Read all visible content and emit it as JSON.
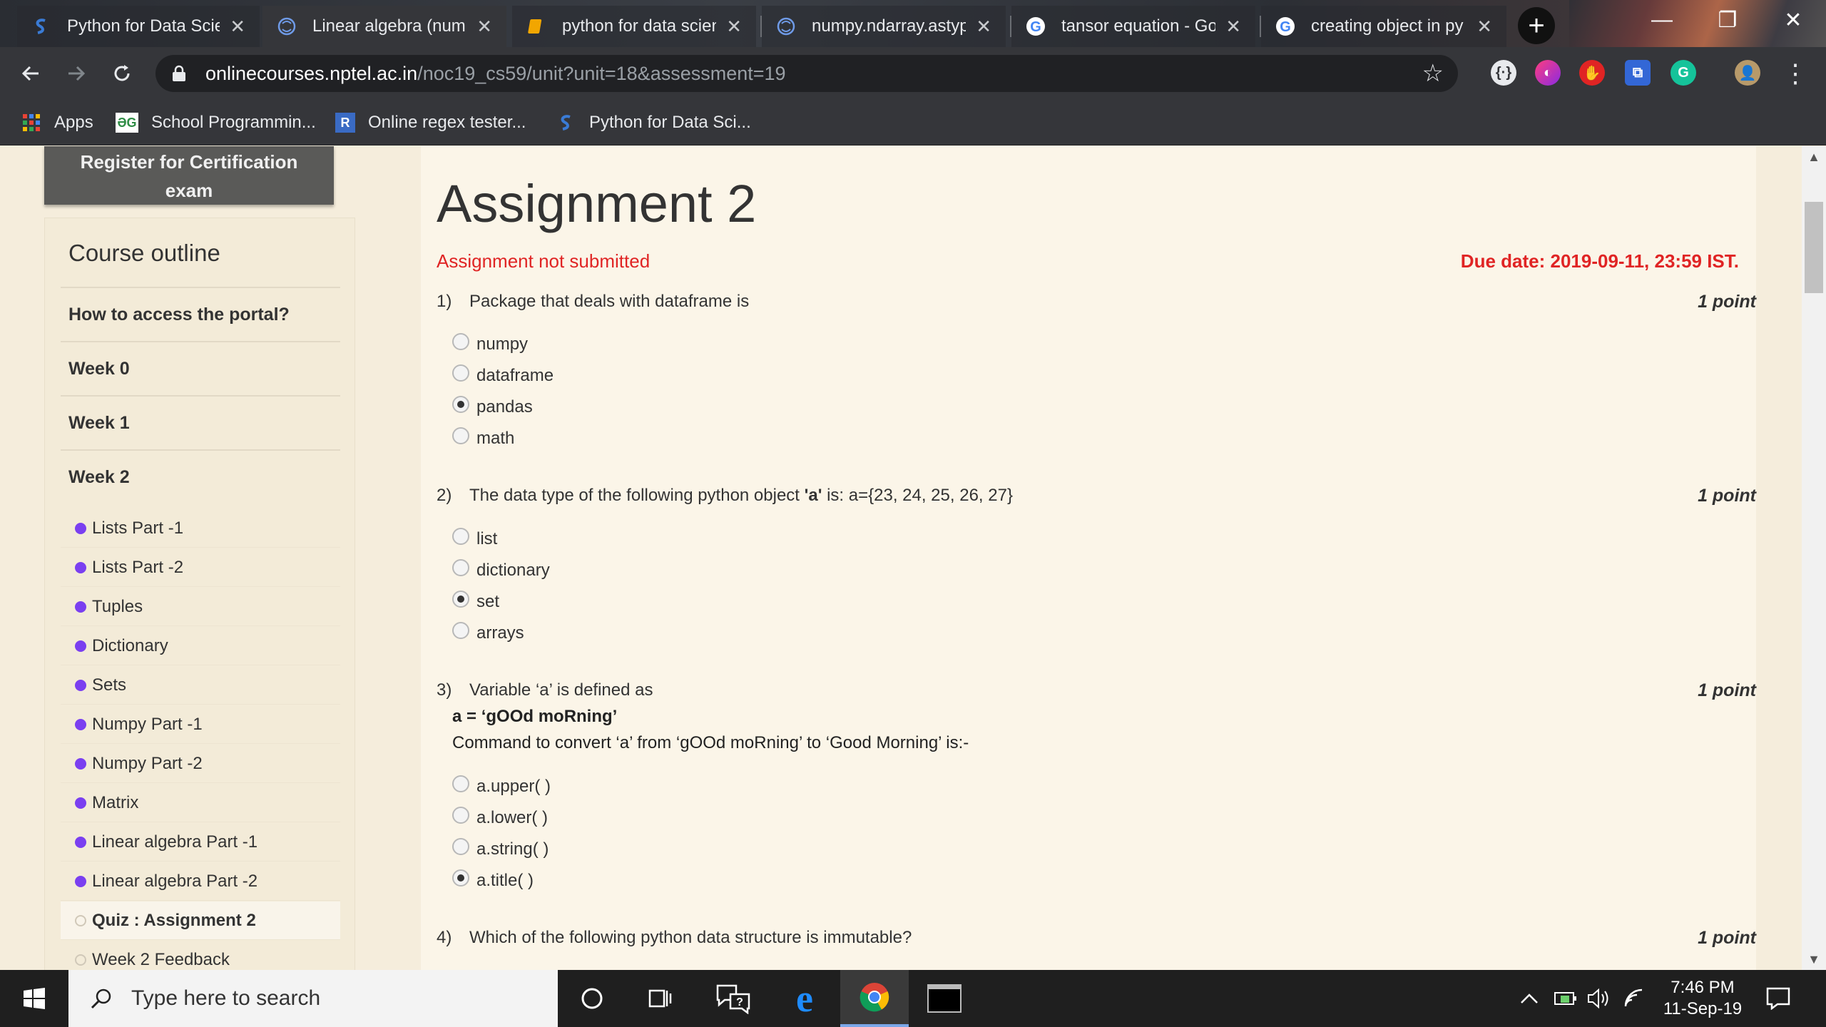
{
  "browser": {
    "tabs": [
      {
        "title": "Python for Data Scie",
        "favicon": "swayam-icon"
      },
      {
        "title": "Linear algebra (nump",
        "favicon": "numpy-icon"
      },
      {
        "title": "python for data scien",
        "favicon": "slides-icon"
      },
      {
        "title": "numpy.ndarray.astyp",
        "favicon": "numpy-icon"
      },
      {
        "title": "tansor equation - Go",
        "favicon": "google-icon"
      },
      {
        "title": "creating object in py",
        "favicon": "google-icon"
      }
    ],
    "url_host": "onlinecourses.nptel.ac.in",
    "url_path": "/noc19_cs59/unit?unit=18&assessment=19",
    "bookmarks": [
      {
        "label": "Apps",
        "icon": "apps-grid-icon"
      },
      {
        "label": "School Programmin...",
        "icon": "geeksforgeeks-icon"
      },
      {
        "label": "Online regex tester...",
        "icon": "regex-icon"
      },
      {
        "label": "Python for Data Sci...",
        "icon": "swayam-icon"
      }
    ]
  },
  "sidebar": {
    "register_label": "Register for Certification exam",
    "outline_title": "Course outline",
    "items": [
      {
        "label": "How to access the portal?"
      },
      {
        "label": "Week 0"
      },
      {
        "label": "Week 1"
      },
      {
        "label": "Week 2"
      }
    ],
    "week2_units": [
      {
        "label": "Lists Part -1",
        "state": "done"
      },
      {
        "label": "Lists Part -2",
        "state": "done"
      },
      {
        "label": "Tuples",
        "state": "done"
      },
      {
        "label": "Dictionary",
        "state": "done"
      },
      {
        "label": "Sets",
        "state": "done"
      },
      {
        "label": "Numpy Part -1",
        "state": "done"
      },
      {
        "label": "Numpy Part -2",
        "state": "done"
      },
      {
        "label": "Matrix",
        "state": "done"
      },
      {
        "label": "Linear algebra Part -1",
        "state": "done"
      },
      {
        "label": "Linear algebra Part -2",
        "state": "done"
      },
      {
        "label": "Quiz : Assignment 2",
        "state": "current"
      },
      {
        "label": "Week 2 Feedback",
        "state": "pending"
      }
    ]
  },
  "assignment": {
    "title": "Assignment 2",
    "status": "Assignment not submitted",
    "due": "Due date: 2019-09-11, 23:59 IST.",
    "questions": [
      {
        "num": "1)",
        "text": "Package that deals with dataframe is",
        "points": "1 point",
        "options": [
          "numpy",
          "dataframe",
          "pandas",
          "math"
        ],
        "selected": 2
      },
      {
        "num": "2)",
        "text_pre": "The data type of the following python object ",
        "text_bold": "'a'",
        "text_post": " is: a={23, 24, 25, 26, 27}",
        "points": "1 point",
        "options": [
          "list",
          "dictionary",
          "set",
          "arrays"
        ],
        "selected": 2
      },
      {
        "num": "3)",
        "text": "Variable ‘a’ is defined as",
        "code": "a = ‘gOOd moRning’",
        "extra": "Command to convert ‘a’ from ‘gOOd moRning’ to ‘Good Morning’ is:-",
        "points": "1 point",
        "options": [
          "a.upper( )",
          "a.lower( )",
          "a.string( )",
          "a.title( )"
        ],
        "selected": 3
      },
      {
        "num": "4)",
        "text": "Which of the following python data structure is immutable?",
        "points": "1 point"
      }
    ]
  },
  "taskbar": {
    "search_placeholder": "Type here to search",
    "time": "7:46 PM",
    "date": "11-Sep-19"
  },
  "colors": {
    "accent_red": "#e02424",
    "unit_dot": "#7a3ff0",
    "page_bg": "#f5eddc"
  }
}
